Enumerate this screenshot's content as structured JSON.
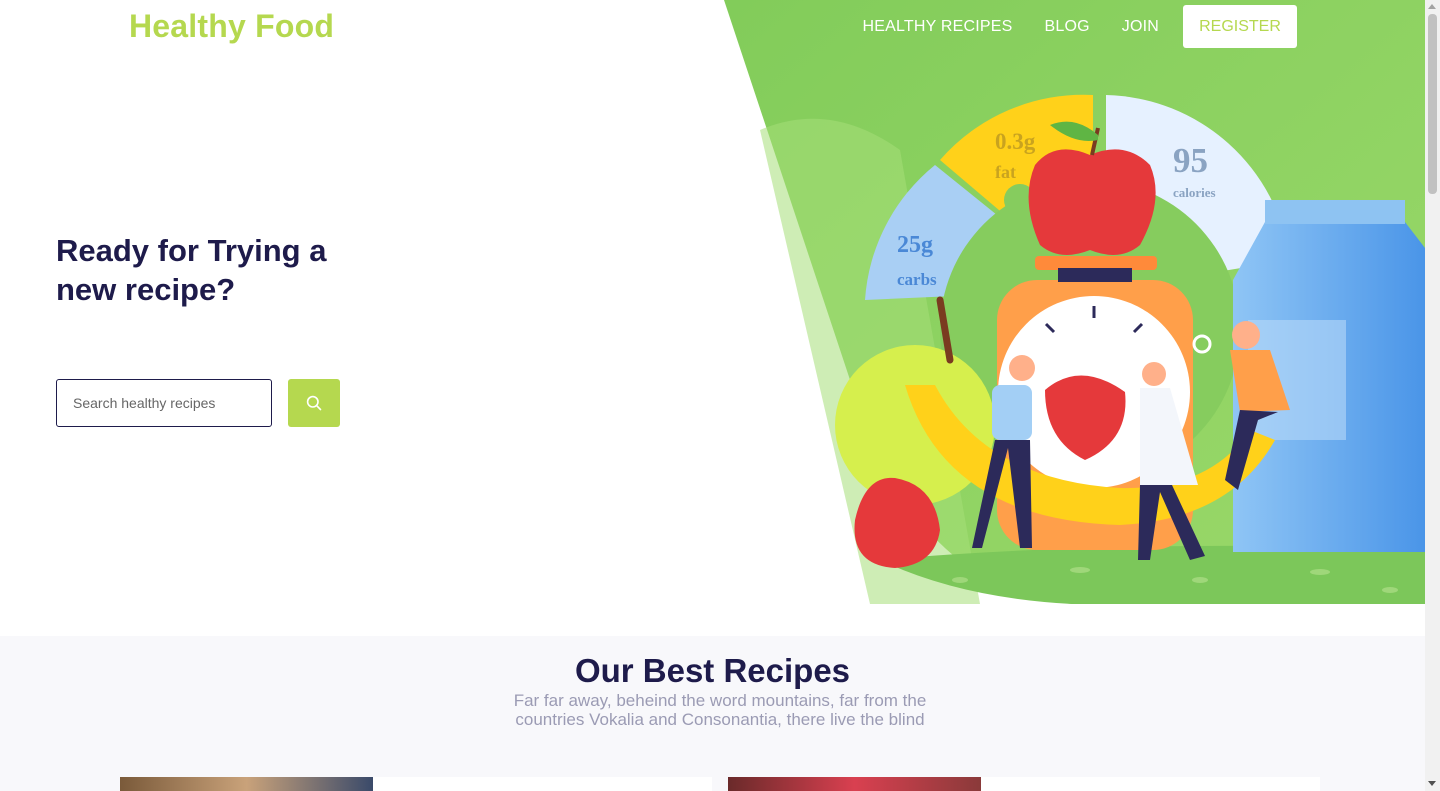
{
  "brand": {
    "logo_text": "Healthy Food",
    "accent_color": "#b5d84f",
    "dark_color": "#1e1b4b"
  },
  "nav": {
    "items": [
      {
        "label": "HEALTHY RECIPES"
      },
      {
        "label": "BLOG"
      },
      {
        "label": "JOIN"
      }
    ],
    "register_label": "REGISTER"
  },
  "hero": {
    "headline": "Ready for Trying a new recipe?",
    "search": {
      "placeholder": "Search healthy recipes",
      "button_icon": "search-icon"
    },
    "illustration": {
      "carbs_value": "25g",
      "carbs_label": "carbs",
      "fat_value": "0.3g",
      "fat_label": "fat",
      "calories_value": "95",
      "calories_label": "calories"
    }
  },
  "recipes_section": {
    "title": "Our Best Recipes",
    "subtitle": "Far far away, beheind the word mountains, far from the countries Vokalia and Consonantia, there live the blind"
  }
}
